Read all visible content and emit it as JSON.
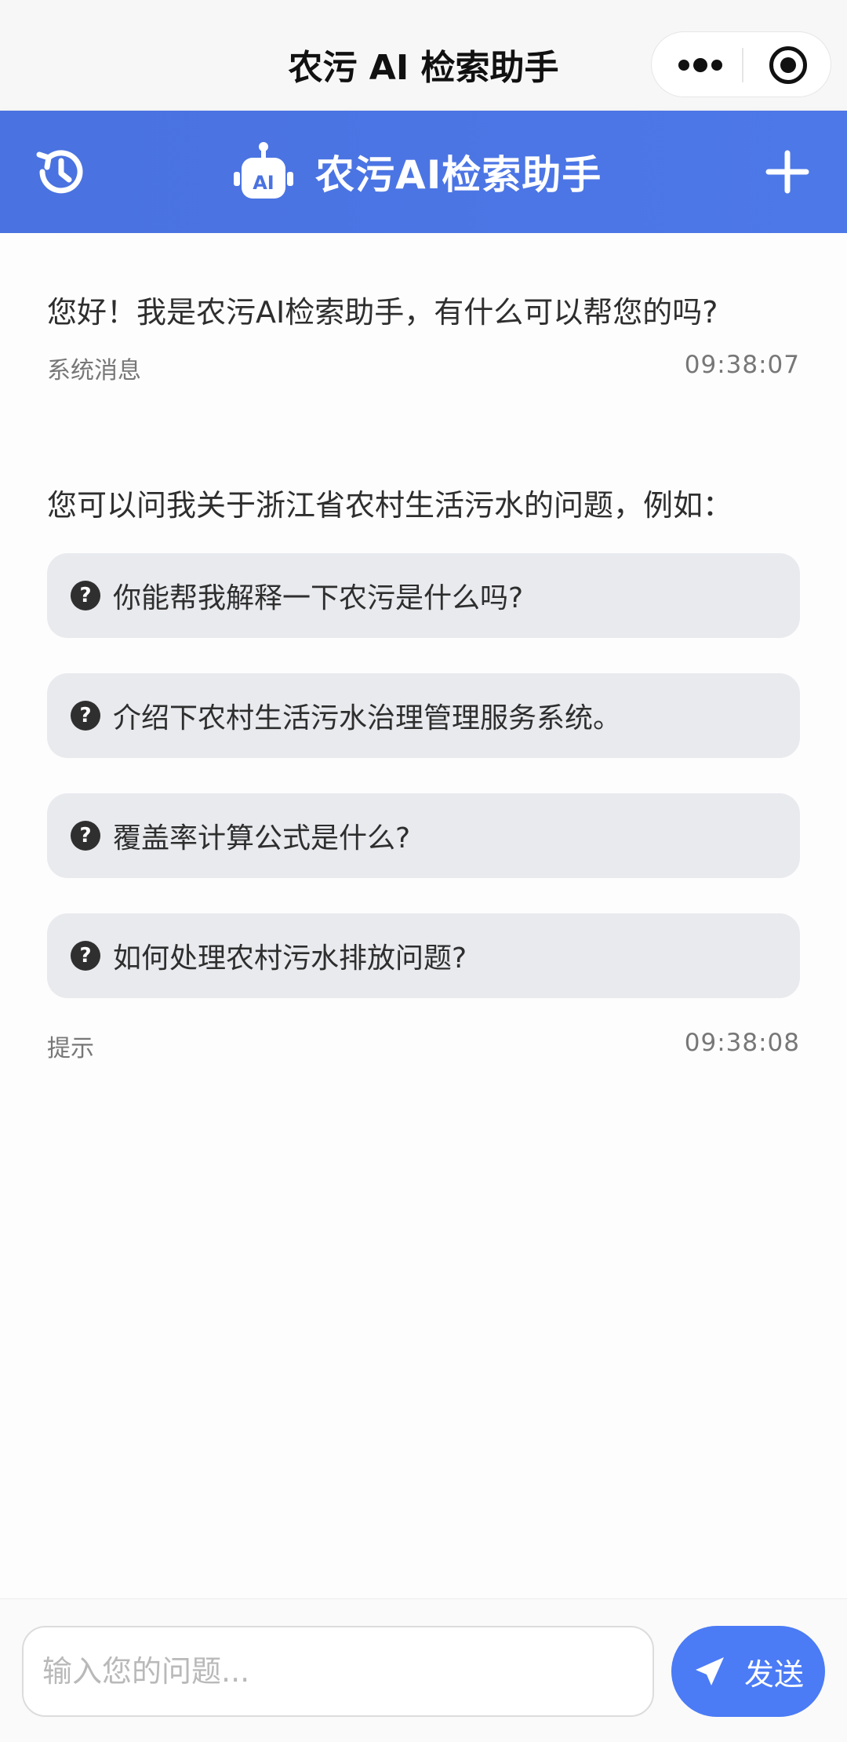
{
  "navbar": {
    "title": "农污 AI 检索助手"
  },
  "header": {
    "title": "农污AI检索助手"
  },
  "messages": {
    "greeting": {
      "text": "您好！我是农污AI检索助手，有什么可以帮您的吗?",
      "label": "系统消息",
      "time": "09:38:07"
    },
    "hint": {
      "intro": "您可以问我关于浙江省农村生活污水的问题，例如：",
      "suggestions": [
        "你能帮我解释一下农污是什么吗?",
        "介绍下农村生活污水治理管理服务系统。",
        "覆盖率计算公式是什么?",
        "如何处理农村污水排放问题?"
      ],
      "label": "提示",
      "time": "09:38:08"
    }
  },
  "input": {
    "placeholder": "输入您的问题...",
    "value": ""
  },
  "send_button": {
    "label": "发送"
  },
  "colors": {
    "header": "#4a72e0",
    "send": "#4b7bf5",
    "chip": "#e8eaee"
  }
}
